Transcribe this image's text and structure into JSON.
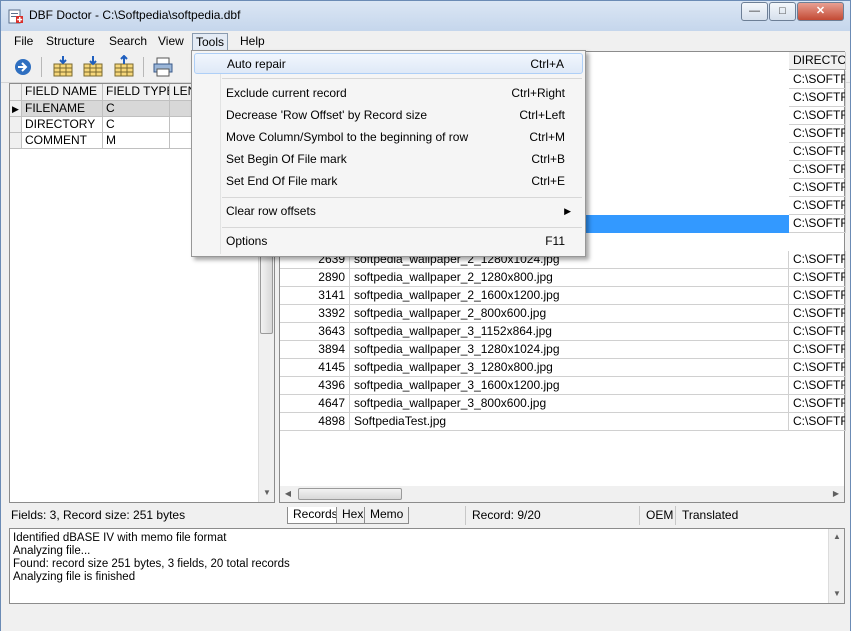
{
  "window": {
    "title": "DBF Doctor - C:\\Softpedia\\softpedia.dbf",
    "min_label": "—",
    "max_label": "□",
    "close_label": "✕"
  },
  "menu": {
    "items": [
      "File",
      "Structure",
      "Search",
      "View",
      "Tools",
      "Help"
    ]
  },
  "toolbar": {
    "icons": [
      "open-icon",
      "insert-field-icon",
      "move-down-icon",
      "move-up-icon",
      "print-icon"
    ]
  },
  "fields_grid": {
    "headers": [
      "FIELD NAME",
      "FIELD TYPE",
      "LEN"
    ],
    "rows": [
      {
        "name": "FILENAME",
        "type": "C"
      },
      {
        "name": "DIRECTORY",
        "type": "C"
      },
      {
        "name": "COMMENT",
        "type": "M"
      }
    ]
  },
  "tools_menu": {
    "items": [
      {
        "label": "Auto repair",
        "shortcut": "Ctrl+A"
      },
      {
        "label": "Exclude current record",
        "shortcut": "Ctrl+Right"
      },
      {
        "label": "Decrease 'Row Offset' by Record size",
        "shortcut": "Ctrl+Left"
      },
      {
        "label": "Move Column/Symbol to the beginning of row",
        "shortcut": "Ctrl+M"
      },
      {
        "label": "Set Begin Of File mark",
        "shortcut": "Ctrl+B"
      },
      {
        "label": "Set End Of File mark",
        "shortcut": "Ctrl+E"
      },
      {
        "label": "Clear row offsets",
        "shortcut": ""
      },
      {
        "label": "Options",
        "shortcut": "F11"
      }
    ]
  },
  "records_grid": {
    "dir_header": "DIRECTO",
    "dir_value": "C:\\SOFTF",
    "rows": [
      {
        "offset": "2639",
        "filename": "softpedia_wallpaper_2_1280x1024.jpg"
      },
      {
        "offset": "2890",
        "filename": "softpedia_wallpaper_2_1280x800.jpg"
      },
      {
        "offset": "3141",
        "filename": "softpedia_wallpaper_2_1600x1200.jpg"
      },
      {
        "offset": "3392",
        "filename": "softpedia_wallpaper_2_800x600.jpg"
      },
      {
        "offset": "3643",
        "filename": "softpedia_wallpaper_3_1152x864.jpg"
      },
      {
        "offset": "3894",
        "filename": "softpedia_wallpaper_3_1280x1024.jpg"
      },
      {
        "offset": "4145",
        "filename": "softpedia_wallpaper_3_1280x800.jpg"
      },
      {
        "offset": "4396",
        "filename": "softpedia_wallpaper_3_1600x1200.jpg"
      },
      {
        "offset": "4647",
        "filename": "softpedia_wallpaper_3_800x600.jpg"
      },
      {
        "offset": "4898",
        "filename": "SoftpediaTest.jpg"
      }
    ]
  },
  "status": {
    "fields_info": "Fields: 3, Record size: 251 bytes",
    "tabs": [
      "Records",
      "Hex",
      "Memo"
    ],
    "record": "Record: 9/20",
    "encoding": "OEM",
    "translated": "Translated"
  },
  "log": {
    "lines": [
      "Identified dBASE IV with memo file format",
      "Analyzing file...",
      "Found: record size 251 bytes, 3 fields, 20 total records",
      "Analyzing file is finished"
    ]
  },
  "colors": {
    "selection": "#3399ff",
    "titlebar": "#c5d6ec",
    "menu_bg": "#f5f5f5"
  }
}
